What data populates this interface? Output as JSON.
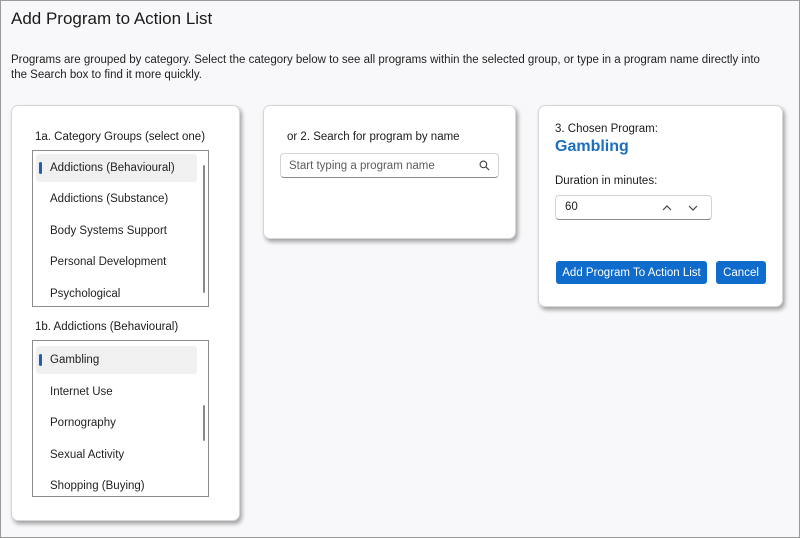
{
  "page": {
    "title": "Add Program to Action List",
    "description": "Programs are grouped by category. Select the category below to see all programs within the selected group, or type in a program name directly into the Search box to find it more quickly."
  },
  "categories": {
    "label": "1a. Category Groups (select one)",
    "items": [
      {
        "label": "Addictions (Behavioural)",
        "selected": true
      },
      {
        "label": "Addictions (Substance)",
        "selected": false
      },
      {
        "label": "Body Systems Support",
        "selected": false
      },
      {
        "label": "Personal Development",
        "selected": false
      },
      {
        "label": "Psychological",
        "selected": false
      }
    ]
  },
  "programs": {
    "label": "1b. Addictions (Behavioural)",
    "items": [
      {
        "label": "Gambling",
        "selected": true
      },
      {
        "label": "Internet Use",
        "selected": false
      },
      {
        "label": "Pornography",
        "selected": false
      },
      {
        "label": "Sexual Activity",
        "selected": false
      },
      {
        "label": "Shopping (Buying)",
        "selected": false
      }
    ]
  },
  "search": {
    "label": "or 2. Search for program by name",
    "placeholder": "Start typing a program name",
    "value": ""
  },
  "chosen": {
    "label": "3. Chosen Program:",
    "program": "Gambling",
    "duration_label": "Duration in minutes:",
    "duration_value": "60"
  },
  "buttons": {
    "add": "Add Program To Action List",
    "cancel": "Cancel"
  },
  "colors": {
    "accent": "#0f6ccc",
    "chosen_text": "#1a6fc0",
    "selection_indicator": "#1c5fb8"
  },
  "icons": {
    "search": "search-icon",
    "increment": "chevron-up-icon",
    "decrement": "chevron-down-icon"
  }
}
